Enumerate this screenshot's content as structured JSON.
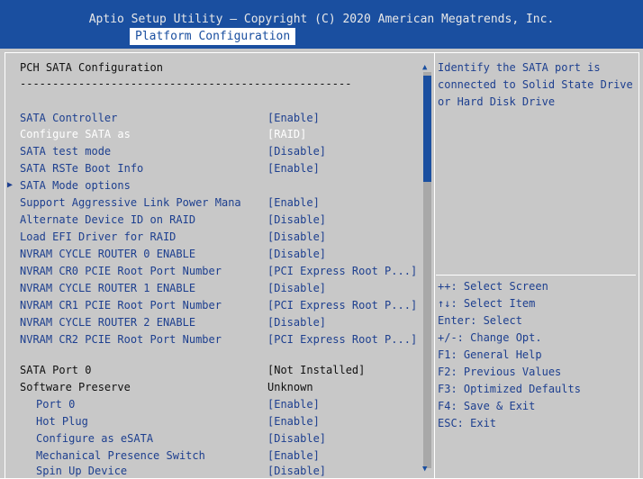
{
  "header": {
    "title": "Aptio Setup Utility – Copyright (C) 2020 American Megatrends, Inc.",
    "active_tab": "Platform Configuration"
  },
  "section": {
    "title": "PCH SATA Configuration",
    "divider": "----------------------------------------------------"
  },
  "settings": [
    {
      "label": "SATA Controller",
      "value": "[Enable]"
    },
    {
      "label": "Configure SATA as",
      "value": "[RAID]"
    },
    {
      "label": "SATA test mode",
      "value": "[Disable]"
    },
    {
      "label": "SATA RSTe Boot Info",
      "value": "[Enable]"
    },
    {
      "label": "SATA Mode options",
      "value": ""
    },
    {
      "label": "Support Aggressive Link Power Mana",
      "value": "[Enable]"
    },
    {
      "label": "Alternate Device ID on RAID",
      "value": "[Disable]"
    },
    {
      "label": "Load EFI Driver for RAID",
      "value": "[Disable]"
    },
    {
      "label": "NVRAM CYCLE ROUTER 0 ENABLE",
      "value": "[Disable]"
    },
    {
      "label": "NVRAM CR0 PCIE Root Port Number",
      "value": "[PCI Express Root P...]"
    },
    {
      "label": "NVRAM CYCLE ROUTER 1 ENABLE",
      "value": "[Disable]"
    },
    {
      "label": "NVRAM CR1 PCIE Root Port Number",
      "value": "[PCI Express Root P...]"
    },
    {
      "label": "NVRAM CYCLE ROUTER 2 ENABLE",
      "value": "[Disable]"
    },
    {
      "label": "NVRAM CR2 PCIE Root Port Number",
      "value": "[PCI Express Root P...]"
    }
  ],
  "port": {
    "title": "SATA Port 0",
    "status": "[Not Installed]",
    "preserve_label": "Software Preserve",
    "preserve_value": "Unknown",
    "items": [
      {
        "label": "Port 0",
        "value": "[Enable]"
      },
      {
        "label": "Hot Plug",
        "value": "[Enable]"
      },
      {
        "label": "Configure as eSATA",
        "value": "[Disable]"
      },
      {
        "label": "Mechanical Presence Switch",
        "value": "[Enable]"
      },
      {
        "label": "Spin Up Device",
        "value": "[Disable]"
      }
    ]
  },
  "help": {
    "lines": [
      "Identify the SATA port is",
      "connected to Solid State Drive",
      "or Hard Disk Drive"
    ]
  },
  "keys": [
    "++: Select Screen",
    "↑↓: Select Item",
    "Enter: Select",
    "+/-: Change Opt.",
    "F1: General Help",
    "F2: Previous Values",
    "F3: Optimized Defaults",
    "F4: Save & Exit",
    "ESC: Exit"
  ],
  "icons": {
    "submenu_arrow": "triangle-right-icon",
    "scroll_up": "triangle-up-icon",
    "scroll_down": "triangle-down-icon"
  },
  "colors": {
    "header_bg": "#1a4fa0",
    "panel_bg": "#c8c8c8",
    "text_blue": "#1d3f8f",
    "selected_text": "#ffffff"
  }
}
